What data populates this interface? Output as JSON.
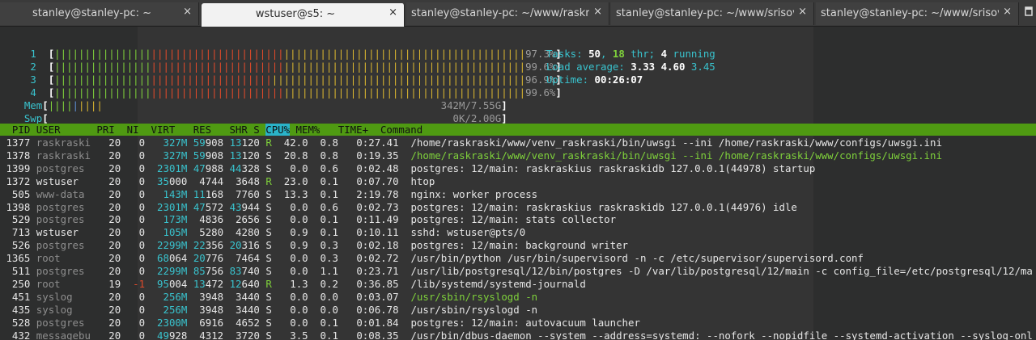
{
  "tabs": [
    {
      "label": "stanley@stanley-pc: ~",
      "active": false,
      "close": "×"
    },
    {
      "label": "wstuser@s5: ~",
      "active": true,
      "close": "×"
    },
    {
      "label": "stanley@stanley-pc: ~/www/raskrask...",
      "active": false,
      "close": "×"
    },
    {
      "label": "stanley@stanley-pc: ~/www/srisovk...",
      "active": false,
      "close": "×"
    },
    {
      "label": "stanley@stanley-pc: ~/www/srisovk...",
      "active": false,
      "close": "×"
    }
  ],
  "meters": {
    "cpus": [
      {
        "id": "1",
        "percent": "97.3%"
      },
      {
        "id": "2",
        "percent": "99.6%"
      },
      {
        "id": "3",
        "percent": "96.9%"
      },
      {
        "id": "4",
        "percent": "99.6%"
      }
    ],
    "mem": {
      "label": "Mem",
      "value": "342M/7.55G"
    },
    "swp": {
      "label": "Swp",
      "value": "0K/2.00G"
    }
  },
  "summary": {
    "tasks_label": "Tasks: ",
    "tasks": "50",
    "thr": "18",
    "thr_label": " thr; ",
    "running": "4",
    "running_label": " running",
    "load_label": "Load average: ",
    "load1": "3.33",
    "load5": "4.60",
    "load15": "3.45",
    "uptime_label": "Uptime: ",
    "uptime": "00:26:07"
  },
  "header": {
    "before_sort": "  PID USER      PRI  NI  VIRT   RES   SHR S ",
    "sort": "CPU%",
    "after_sort": " MEM%   TIME+  Command"
  },
  "colors": {
    "header_bg": "#4f9a12",
    "sort_bg": "#2ab3c9",
    "accent_cyan": "#39c3ce",
    "thread_green": "#7fd13b"
  },
  "processes": [
    {
      "pid": "1377",
      "user": "raskraski",
      "pri": "20",
      "ni": "0",
      "virt": "327M",
      "res": "59908",
      "shr": "13120",
      "s": "R",
      "cpu": "42.0",
      "mem": "0.8",
      "time": "0:27.41",
      "cmd": "/home/raskraski/www/venv_raskraski/bin/uwsgi --ini /home/raskraski/www/configs/uwsgi.ini",
      "thread": false
    },
    {
      "pid": "1378",
      "user": "raskraski",
      "pri": "20",
      "ni": "0",
      "virt": "327M",
      "res": "59908",
      "shr": "13120",
      "s": "S",
      "cpu": "20.8",
      "mem": "0.8",
      "time": "0:19.35",
      "cmd": "/home/raskraski/www/venv_raskraski/bin/uwsgi --ini /home/raskraski/www/configs/uwsgi.ini",
      "thread": true
    },
    {
      "pid": "1399",
      "user": "postgres",
      "pri": "20",
      "ni": "0",
      "virt": "2301M",
      "res": "47988",
      "shr": "44328",
      "s": "S",
      "cpu": "0.0",
      "mem": "0.6",
      "time": "0:02.48",
      "cmd": "postgres: 12/main: raskraskius raskraskidb 127.0.0.1(44978) startup",
      "thread": false
    },
    {
      "pid": "1372",
      "user": "wstuser",
      "pri": "20",
      "ni": "0",
      "virt": "35000",
      "res": "4744",
      "shr": "3648",
      "s": "R",
      "cpu": "23.0",
      "mem": "0.1",
      "time": "0:07.70",
      "cmd": "htop",
      "thread": false
    },
    {
      "pid": "505",
      "user": "www-data",
      "pri": "20",
      "ni": "0",
      "virt": "143M",
      "res": "11168",
      "shr": "7760",
      "s": "S",
      "cpu": "13.3",
      "mem": "0.1",
      "time": "2:19.78",
      "cmd": "nginx: worker process",
      "thread": false
    },
    {
      "pid": "1398",
      "user": "postgres",
      "pri": "20",
      "ni": "0",
      "virt": "2301M",
      "res": "47572",
      "shr": "43944",
      "s": "S",
      "cpu": "0.0",
      "mem": "0.6",
      "time": "0:02.73",
      "cmd": "postgres: 12/main: raskraskius raskraskidb 127.0.0.1(44976) idle",
      "thread": false
    },
    {
      "pid": "529",
      "user": "postgres",
      "pri": "20",
      "ni": "0",
      "virt": "173M",
      "res": "4836",
      "shr": "2656",
      "s": "S",
      "cpu": "0.0",
      "mem": "0.1",
      "time": "0:11.49",
      "cmd": "postgres: 12/main: stats collector",
      "thread": false
    },
    {
      "pid": "713",
      "user": "wstuser",
      "pri": "20",
      "ni": "0",
      "virt": "105M",
      "res": "5280",
      "shr": "4280",
      "s": "S",
      "cpu": "0.9",
      "mem": "0.1",
      "time": "0:10.11",
      "cmd": "sshd: wstuser@pts/0",
      "thread": false
    },
    {
      "pid": "526",
      "user": "postgres",
      "pri": "20",
      "ni": "0",
      "virt": "2299M",
      "res": "22356",
      "shr": "20316",
      "s": "S",
      "cpu": "0.9",
      "mem": "0.3",
      "time": "0:02.18",
      "cmd": "postgres: 12/main: background writer",
      "thread": false
    },
    {
      "pid": "1365",
      "user": "root",
      "pri": "20",
      "ni": "0",
      "virt": "68064",
      "res": "20776",
      "shr": "7464",
      "s": "S",
      "cpu": "0.0",
      "mem": "0.3",
      "time": "0:02.72",
      "cmd": "/usr/bin/python /usr/bin/supervisord -n -c /etc/supervisor/supervisord.conf",
      "thread": false
    },
    {
      "pid": "511",
      "user": "postgres",
      "pri": "20",
      "ni": "0",
      "virt": "2299M",
      "res": "85756",
      "shr": "83740",
      "s": "S",
      "cpu": "0.0",
      "mem": "1.1",
      "time": "0:23.71",
      "cmd": "/usr/lib/postgresql/12/bin/postgres -D /var/lib/postgresql/12/main -c config_file=/etc/postgresql/12/ma",
      "thread": false
    },
    {
      "pid": "250",
      "user": "root",
      "pri": "19",
      "ni": "-1",
      "virt": "95004",
      "res": "13472",
      "shr": "12640",
      "s": "R",
      "cpu": "1.3",
      "mem": "0.2",
      "time": "0:36.85",
      "cmd": "/lib/systemd/systemd-journald",
      "thread": false
    },
    {
      "pid": "451",
      "user": "syslog",
      "pri": "20",
      "ni": "0",
      "virt": "256M",
      "res": "3948",
      "shr": "3440",
      "s": "S",
      "cpu": "0.0",
      "mem": "0.0",
      "time": "0:03.07",
      "cmd": "/usr/sbin/rsyslogd -n",
      "thread": true
    },
    {
      "pid": "435",
      "user": "syslog",
      "pri": "20",
      "ni": "0",
      "virt": "256M",
      "res": "3948",
      "shr": "3440",
      "s": "S",
      "cpu": "0.0",
      "mem": "0.0",
      "time": "0:06.78",
      "cmd": "/usr/sbin/rsyslogd -n",
      "thread": false
    },
    {
      "pid": "528",
      "user": "postgres",
      "pri": "20",
      "ni": "0",
      "virt": "2300M",
      "res": "6916",
      "shr": "4652",
      "s": "S",
      "cpu": "0.0",
      "mem": "0.1",
      "time": "0:01.84",
      "cmd": "postgres: 12/main: autovacuum launcher",
      "thread": false
    },
    {
      "pid": "432",
      "user": "messagebu",
      "pri": "20",
      "ni": "0",
      "virt": "49928",
      "res": "4312",
      "shr": "3720",
      "s": "S",
      "cpu": "3.5",
      "mem": "0.1",
      "time": "0:08.35",
      "cmd": "/usr/bin/dbus-daemon --system --address=systemd: --nofork --nopidfile --systemd-activation --syslog-onl",
      "thread": false
    }
  ]
}
